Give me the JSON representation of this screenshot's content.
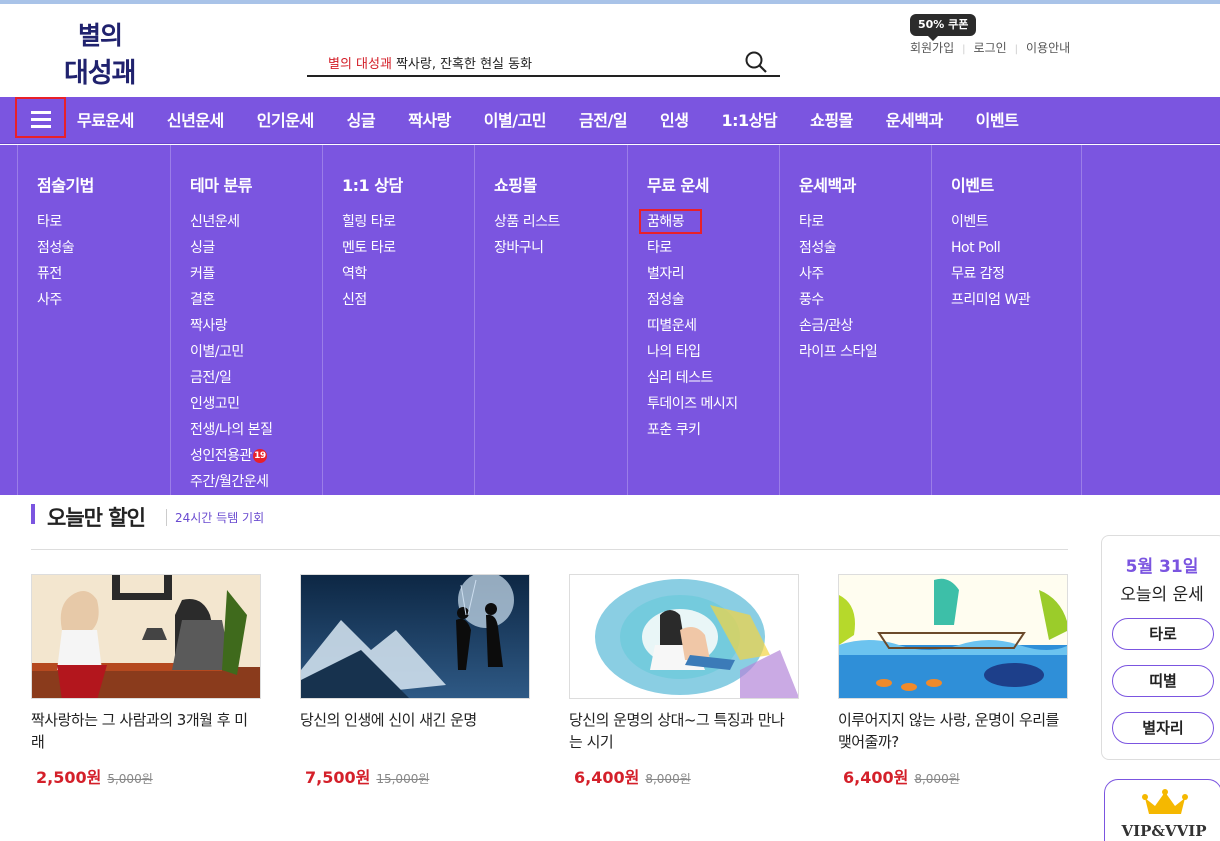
{
  "logo": {
    "line1": "별의",
    "line2": "대성괘"
  },
  "search": {
    "keyword_red": "별의 대성괘",
    "keyword_text": "짝사랑, 잔혹한 현실 동화"
  },
  "coupon": "50% 쿠폰",
  "util": {
    "join": "회원가입",
    "login": "로그인",
    "guide": "이용안내"
  },
  "nav": [
    "무료운세",
    "신년운세",
    "인기운세",
    "싱글",
    "짝사랑",
    "이별/고민",
    "금전/일",
    "인생",
    "1:1상담",
    "쇼핑몰",
    "운세백과",
    "이벤트"
  ],
  "mega": [
    {
      "title": "점술기법",
      "items": [
        "타로",
        "점성술",
        "퓨전",
        "사주"
      ]
    },
    {
      "title": "테마 분류",
      "items": [
        "신년운세",
        "싱글",
        "커플",
        "결혼",
        "짝사랑",
        "이별/고민",
        "금전/일",
        "인생고민",
        "전생/나의 본질",
        "성인전용관",
        "주간/월간운세"
      ],
      "badge": "19"
    },
    {
      "title": "1:1 상담",
      "items": [
        "힐링 타로",
        "멘토 타로",
        "역학",
        "신점"
      ]
    },
    {
      "title": "쇼핑몰",
      "items": [
        "상품 리스트",
        "장바구니"
      ]
    },
    {
      "title": "무료 운세",
      "items": [
        "꿈해몽",
        "타로",
        "별자리",
        "점성술",
        "띠별운세",
        "나의 타입",
        "심리 테스트",
        "투데이즈 메시지",
        "포춘 쿠키"
      ]
    },
    {
      "title": "운세백과",
      "items": [
        "타로",
        "점성술",
        "사주",
        "풍수",
        "손금/관상",
        "라이프 스타일"
      ]
    },
    {
      "title": "이벤트",
      "items": [
        "이벤트",
        "Hot Poll",
        "무료 감정",
        "프리미엄 W관"
      ]
    }
  ],
  "section": {
    "title": "오늘만 할인",
    "subtitle": "24시간 득템 기회"
  },
  "products": [
    {
      "title": "짝사랑하는 그 사람과의 3개월 후 미래",
      "price": "2,500원",
      "old_price": "5,000원"
    },
    {
      "title": "당신의 인생에 신이 새긴 운명",
      "price": "7,500원",
      "old_price": "15,000원"
    },
    {
      "title": "당신의 운명의 상대~그 특징과 만나는 시기",
      "price": "6,400원",
      "old_price": "8,000원"
    },
    {
      "title": "이루어지지 않는 사랑, 운명이 우리를 맺어줄까?",
      "price": "6,400원",
      "old_price": "8,000원"
    }
  ],
  "side": {
    "date": "5월 31일",
    "label": "오늘의 운세",
    "buttons": [
      "타로",
      "띠별",
      "별자리"
    ]
  },
  "vip": "VIP&VVIP",
  "colors": {
    "accent": "#7b55e0",
    "price": "#d4202a",
    "highlight": "#e8202a"
  }
}
